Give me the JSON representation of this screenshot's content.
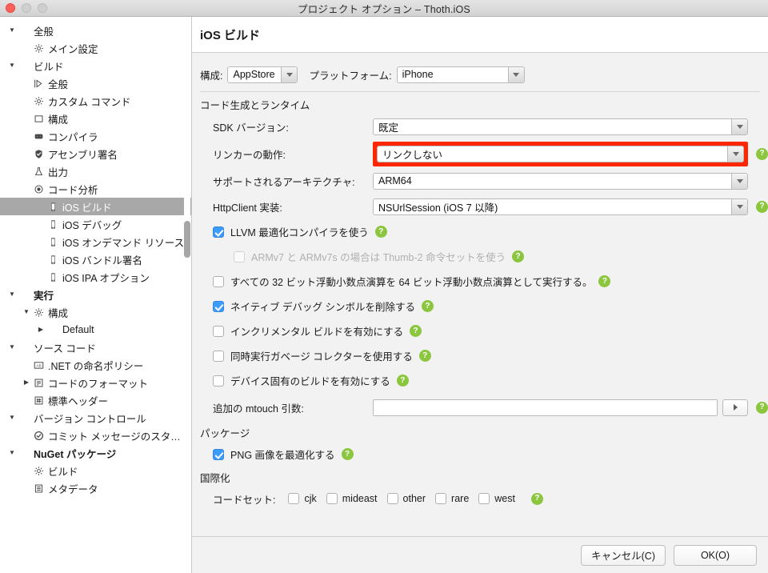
{
  "window": {
    "title": "プロジェクト オプション – Thoth.iOS",
    "traffic_lights": [
      "close-button",
      "minimize-button",
      "maximize-button"
    ]
  },
  "sidebar": {
    "items": [
      {
        "label": "全般",
        "indent": 0,
        "disc": "▼",
        "icon": "",
        "bold": false,
        "selected": false
      },
      {
        "label": "メイン設定",
        "indent": 1,
        "disc": "",
        "icon": "gear-icon",
        "bold": false,
        "selected": false
      },
      {
        "label": "ビルド",
        "indent": 0,
        "disc": "▼",
        "icon": "",
        "bold": false,
        "selected": false
      },
      {
        "label": "全般",
        "indent": 1,
        "disc": "",
        "icon": "play-outline-icon",
        "bold": false,
        "selected": false
      },
      {
        "label": "カスタム コマンド",
        "indent": 1,
        "disc": "",
        "icon": "gear-icon",
        "bold": false,
        "selected": false
      },
      {
        "label": "構成",
        "indent": 1,
        "disc": "",
        "icon": "square-icon",
        "bold": false,
        "selected": false
      },
      {
        "label": "コンパイラ",
        "indent": 1,
        "disc": "",
        "icon": "compiler-icon",
        "bold": false,
        "selected": false
      },
      {
        "label": "アセンブリ署名",
        "indent": 1,
        "disc": "",
        "icon": "signature-icon",
        "bold": false,
        "selected": false
      },
      {
        "label": "出力",
        "indent": 1,
        "disc": "",
        "icon": "flask-icon",
        "bold": false,
        "selected": false
      },
      {
        "label": "コード分析",
        "indent": 1,
        "disc": "",
        "icon": "radio-dot-icon",
        "bold": false,
        "selected": false
      },
      {
        "label": "iOS ビルド",
        "indent": 2,
        "disc": "",
        "icon": "device-icon",
        "bold": false,
        "selected": true
      },
      {
        "label": "iOS デバッグ",
        "indent": 2,
        "disc": "",
        "icon": "device-icon",
        "bold": false,
        "selected": false
      },
      {
        "label": "iOS オンデマンド リソース",
        "indent": 2,
        "disc": "",
        "icon": "device-icon",
        "bold": false,
        "selected": false
      },
      {
        "label": "iOS バンドル署名",
        "indent": 2,
        "disc": "",
        "icon": "device-icon",
        "bold": false,
        "selected": false
      },
      {
        "label": "iOS IPA オプション",
        "indent": 2,
        "disc": "",
        "icon": "device-icon",
        "bold": false,
        "selected": false
      },
      {
        "label": "実行",
        "indent": 0,
        "disc": "▼",
        "icon": "",
        "bold": true,
        "selected": false
      },
      {
        "label": "構成",
        "indent": 1,
        "disc": "▼",
        "icon": "gear-icon",
        "bold": false,
        "selected": false
      },
      {
        "label": "Default",
        "indent": 2,
        "disc": "▶",
        "icon": "",
        "bold": false,
        "selected": false
      },
      {
        "label": "ソース コード",
        "indent": 0,
        "disc": "▼",
        "icon": "",
        "bold": false,
        "selected": false
      },
      {
        "label": ".NET の命名ポリシー",
        "indent": 1,
        "disc": "",
        "icon": "abc-icon",
        "bold": false,
        "selected": false
      },
      {
        "label": "コードのフォーマット",
        "indent": 1,
        "disc": "▶",
        "icon": "list-icon",
        "bold": false,
        "selected": false
      },
      {
        "label": "標準ヘッダー",
        "indent": 1,
        "disc": "",
        "icon": "hash-icon",
        "bold": false,
        "selected": false
      },
      {
        "label": "バージョン コントロール",
        "indent": 0,
        "disc": "▼",
        "icon": "",
        "bold": false,
        "selected": false
      },
      {
        "label": "コミット メッセージのスタイル",
        "indent": 1,
        "disc": "",
        "icon": "check-circle-icon",
        "bold": false,
        "selected": false
      },
      {
        "label": "NuGet パッケージ",
        "indent": 0,
        "disc": "▼",
        "icon": "",
        "bold": true,
        "selected": false
      },
      {
        "label": "ビルド",
        "indent": 1,
        "disc": "",
        "icon": "gear-icon",
        "bold": false,
        "selected": false
      },
      {
        "label": "メタデータ",
        "indent": 1,
        "disc": "",
        "icon": "doc-icon",
        "bold": false,
        "selected": false
      }
    ]
  },
  "pane": {
    "title": "iOS ビルド",
    "config": {
      "config_label": "構成:",
      "config_value": "AppStore",
      "platform_label": "プラットフォーム:",
      "platform_value": "iPhone"
    },
    "sections": {
      "codegen": "コード生成とランタイム",
      "package": "パッケージ",
      "i18n": "国際化"
    },
    "fields": {
      "sdk_label": "SDK バージョン:",
      "sdk_value": "既定",
      "linker_label": "リンカーの動作:",
      "linker_value": "リンクしない",
      "arch_label": "サポートされるアーキテクチャ:",
      "arch_value": "ARM64",
      "http_label": "HttpClient 実装:",
      "http_value": "NSUrlSession (iOS 7 以降)",
      "mtouch_label": "追加の mtouch 引数:",
      "mtouch_value": ""
    },
    "checkboxes": {
      "llvm": "LLVM 最適化コンパイラを使う",
      "thumb2": "ARMv7 と ARMv7s の場合は Thumb-2 命令セットを使う",
      "float64": "すべての 32 ビット浮動小数点演算を 64 ビット浮動小数点演算として実行する。",
      "strip_symbols": "ネイティブ デバッグ シンボルを削除する",
      "incremental": "インクリメンタル ビルドを有効にする",
      "concurrent_gc": "同時実行ガベージ コレクターを使用する",
      "device_specific": "デバイス固有のビルドを有効にする",
      "optimize_png": "PNG 画像を最適化する"
    },
    "codeset": {
      "label": "コードセット:",
      "options": [
        {
          "name": "cjk",
          "checked": false
        },
        {
          "name": "mideast",
          "checked": false
        },
        {
          "name": "other",
          "checked": false
        },
        {
          "name": "rare",
          "checked": false
        },
        {
          "name": "west",
          "checked": false
        }
      ]
    },
    "help_glyph": "?"
  },
  "footer": {
    "cancel_label": "キャンセル(C)",
    "ok_label": "OK(O)"
  },
  "colors": {
    "highlight": "#ff2600",
    "selection": "#a8a8a8",
    "checkbox_checked": "#3d9bfb",
    "help_badge": "#8cc63f"
  }
}
